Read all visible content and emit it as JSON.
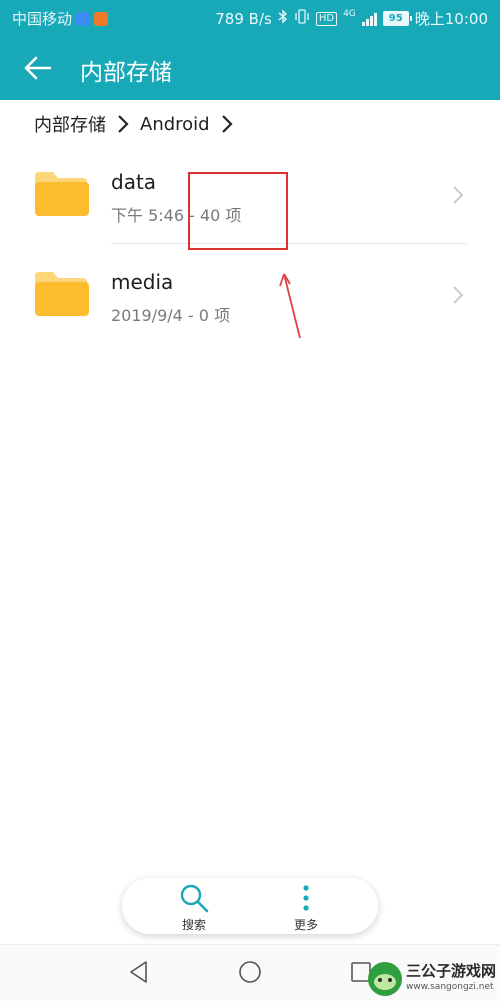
{
  "status_bar": {
    "carrier": "中国移动",
    "net_speed": "789 B/s",
    "network": "4G",
    "hd_badge": "HD",
    "battery": "95",
    "time": "晚上10:00"
  },
  "app_bar": {
    "title": "内部存储",
    "back_icon": "arrow-left-icon"
  },
  "breadcrumb": {
    "items": [
      "内部存储",
      "Android"
    ]
  },
  "files": [
    {
      "name": "data",
      "meta": "下午 5:46 - 40 项",
      "icon": "folder-icon"
    },
    {
      "name": "media",
      "meta": "2019/9/4 - 0 项",
      "icon": "folder-icon"
    }
  ],
  "actions": {
    "search_label": "搜索",
    "more_label": "更多"
  },
  "colors": {
    "accent": "#17a9b8",
    "folder": "#fbbd2d",
    "folder_tab": "#fdd67a",
    "annotation": "#dd3333"
  },
  "watermark": {
    "title": "三公子游戏网",
    "url": "www.sangongzi.net"
  }
}
